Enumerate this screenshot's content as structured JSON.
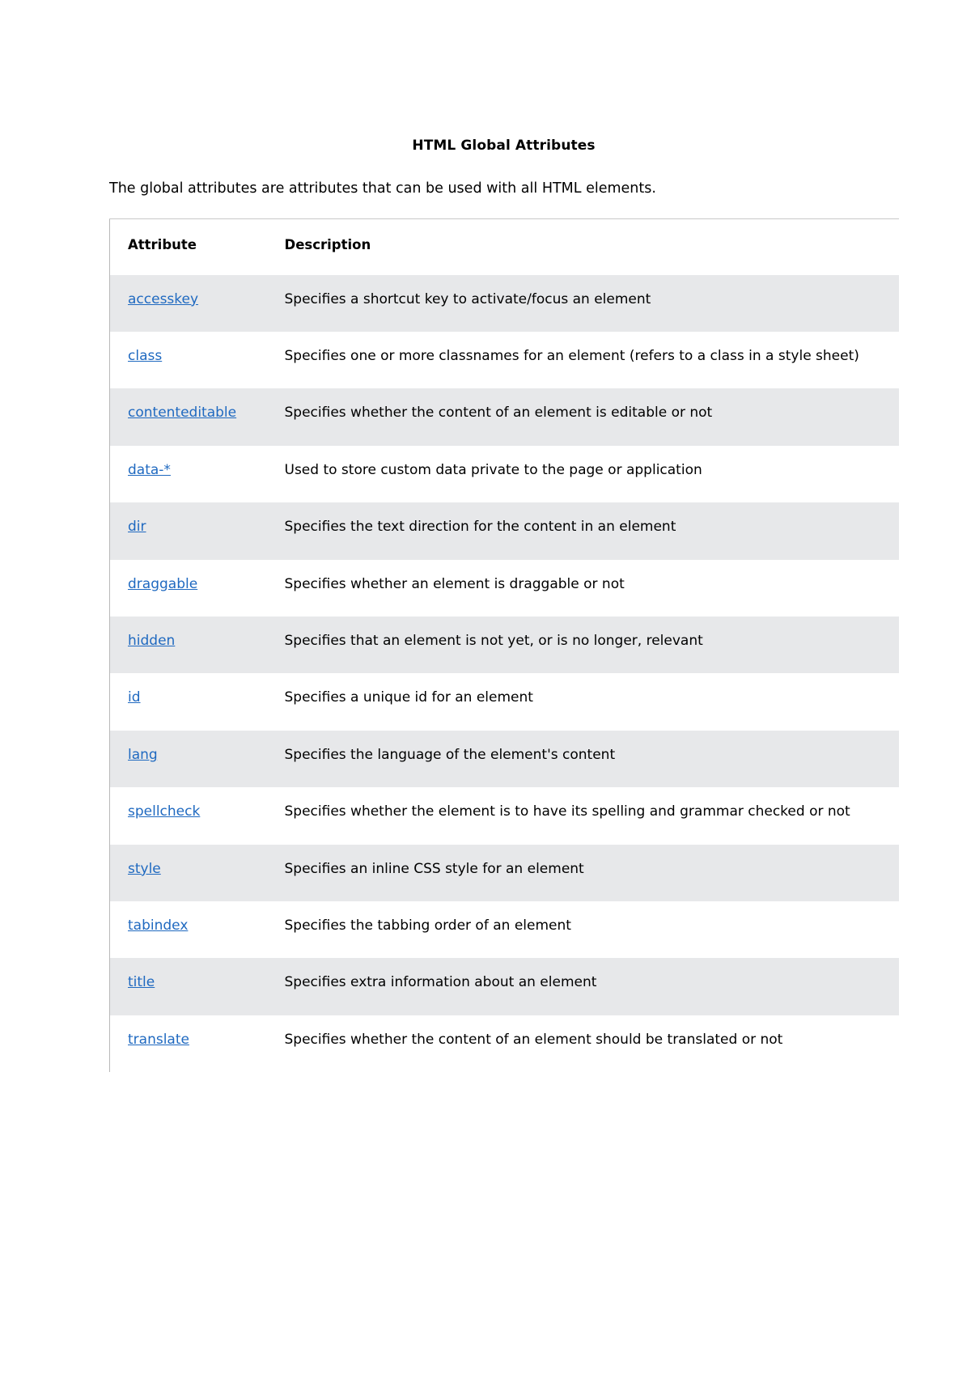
{
  "document": {
    "title": "HTML Global Attributes",
    "intro": "The global attributes are attributes that can be used with all HTML elements."
  },
  "table": {
    "columns": [
      "Attribute",
      "Description"
    ],
    "rows": [
      {
        "attribute": "accesskey",
        "description": "Specifies a shortcut key to activate/focus an element"
      },
      {
        "attribute": "class",
        "description": "Specifies one or more classnames for an element (refers to a class in a style sheet)"
      },
      {
        "attribute": "contenteditable",
        "description": "Specifies whether the content of an element is editable or not"
      },
      {
        "attribute": "data-*",
        "description": "Used to store custom data private to the page or application"
      },
      {
        "attribute": "dir",
        "description": "Specifies the text direction for the content in an element"
      },
      {
        "attribute": "draggable",
        "description": "Specifies whether an element is draggable or not"
      },
      {
        "attribute": "hidden",
        "description": "Specifies that an element is not yet, or is no longer, relevant"
      },
      {
        "attribute": "id",
        "description": "Specifies a unique id for an element"
      },
      {
        "attribute": "lang",
        "description": "Specifies the language of the element's content"
      },
      {
        "attribute": "spellcheck",
        "description": "Specifies whether the element is to have its spelling and grammar checked or not"
      },
      {
        "attribute": "style",
        "description": "Specifies an inline CSS style for an element"
      },
      {
        "attribute": "tabindex",
        "description": "Specifies the tabbing order of an element"
      },
      {
        "attribute": "title",
        "description": "Specifies extra information about an element"
      },
      {
        "attribute": "translate",
        "description": "Specifies whether the content of an element should be translated or not"
      }
    ]
  },
  "colors": {
    "link": "#1f69c0",
    "row_shaded": "#e7e8ea",
    "row_plain": "#ffffff",
    "text": "#000000"
  }
}
